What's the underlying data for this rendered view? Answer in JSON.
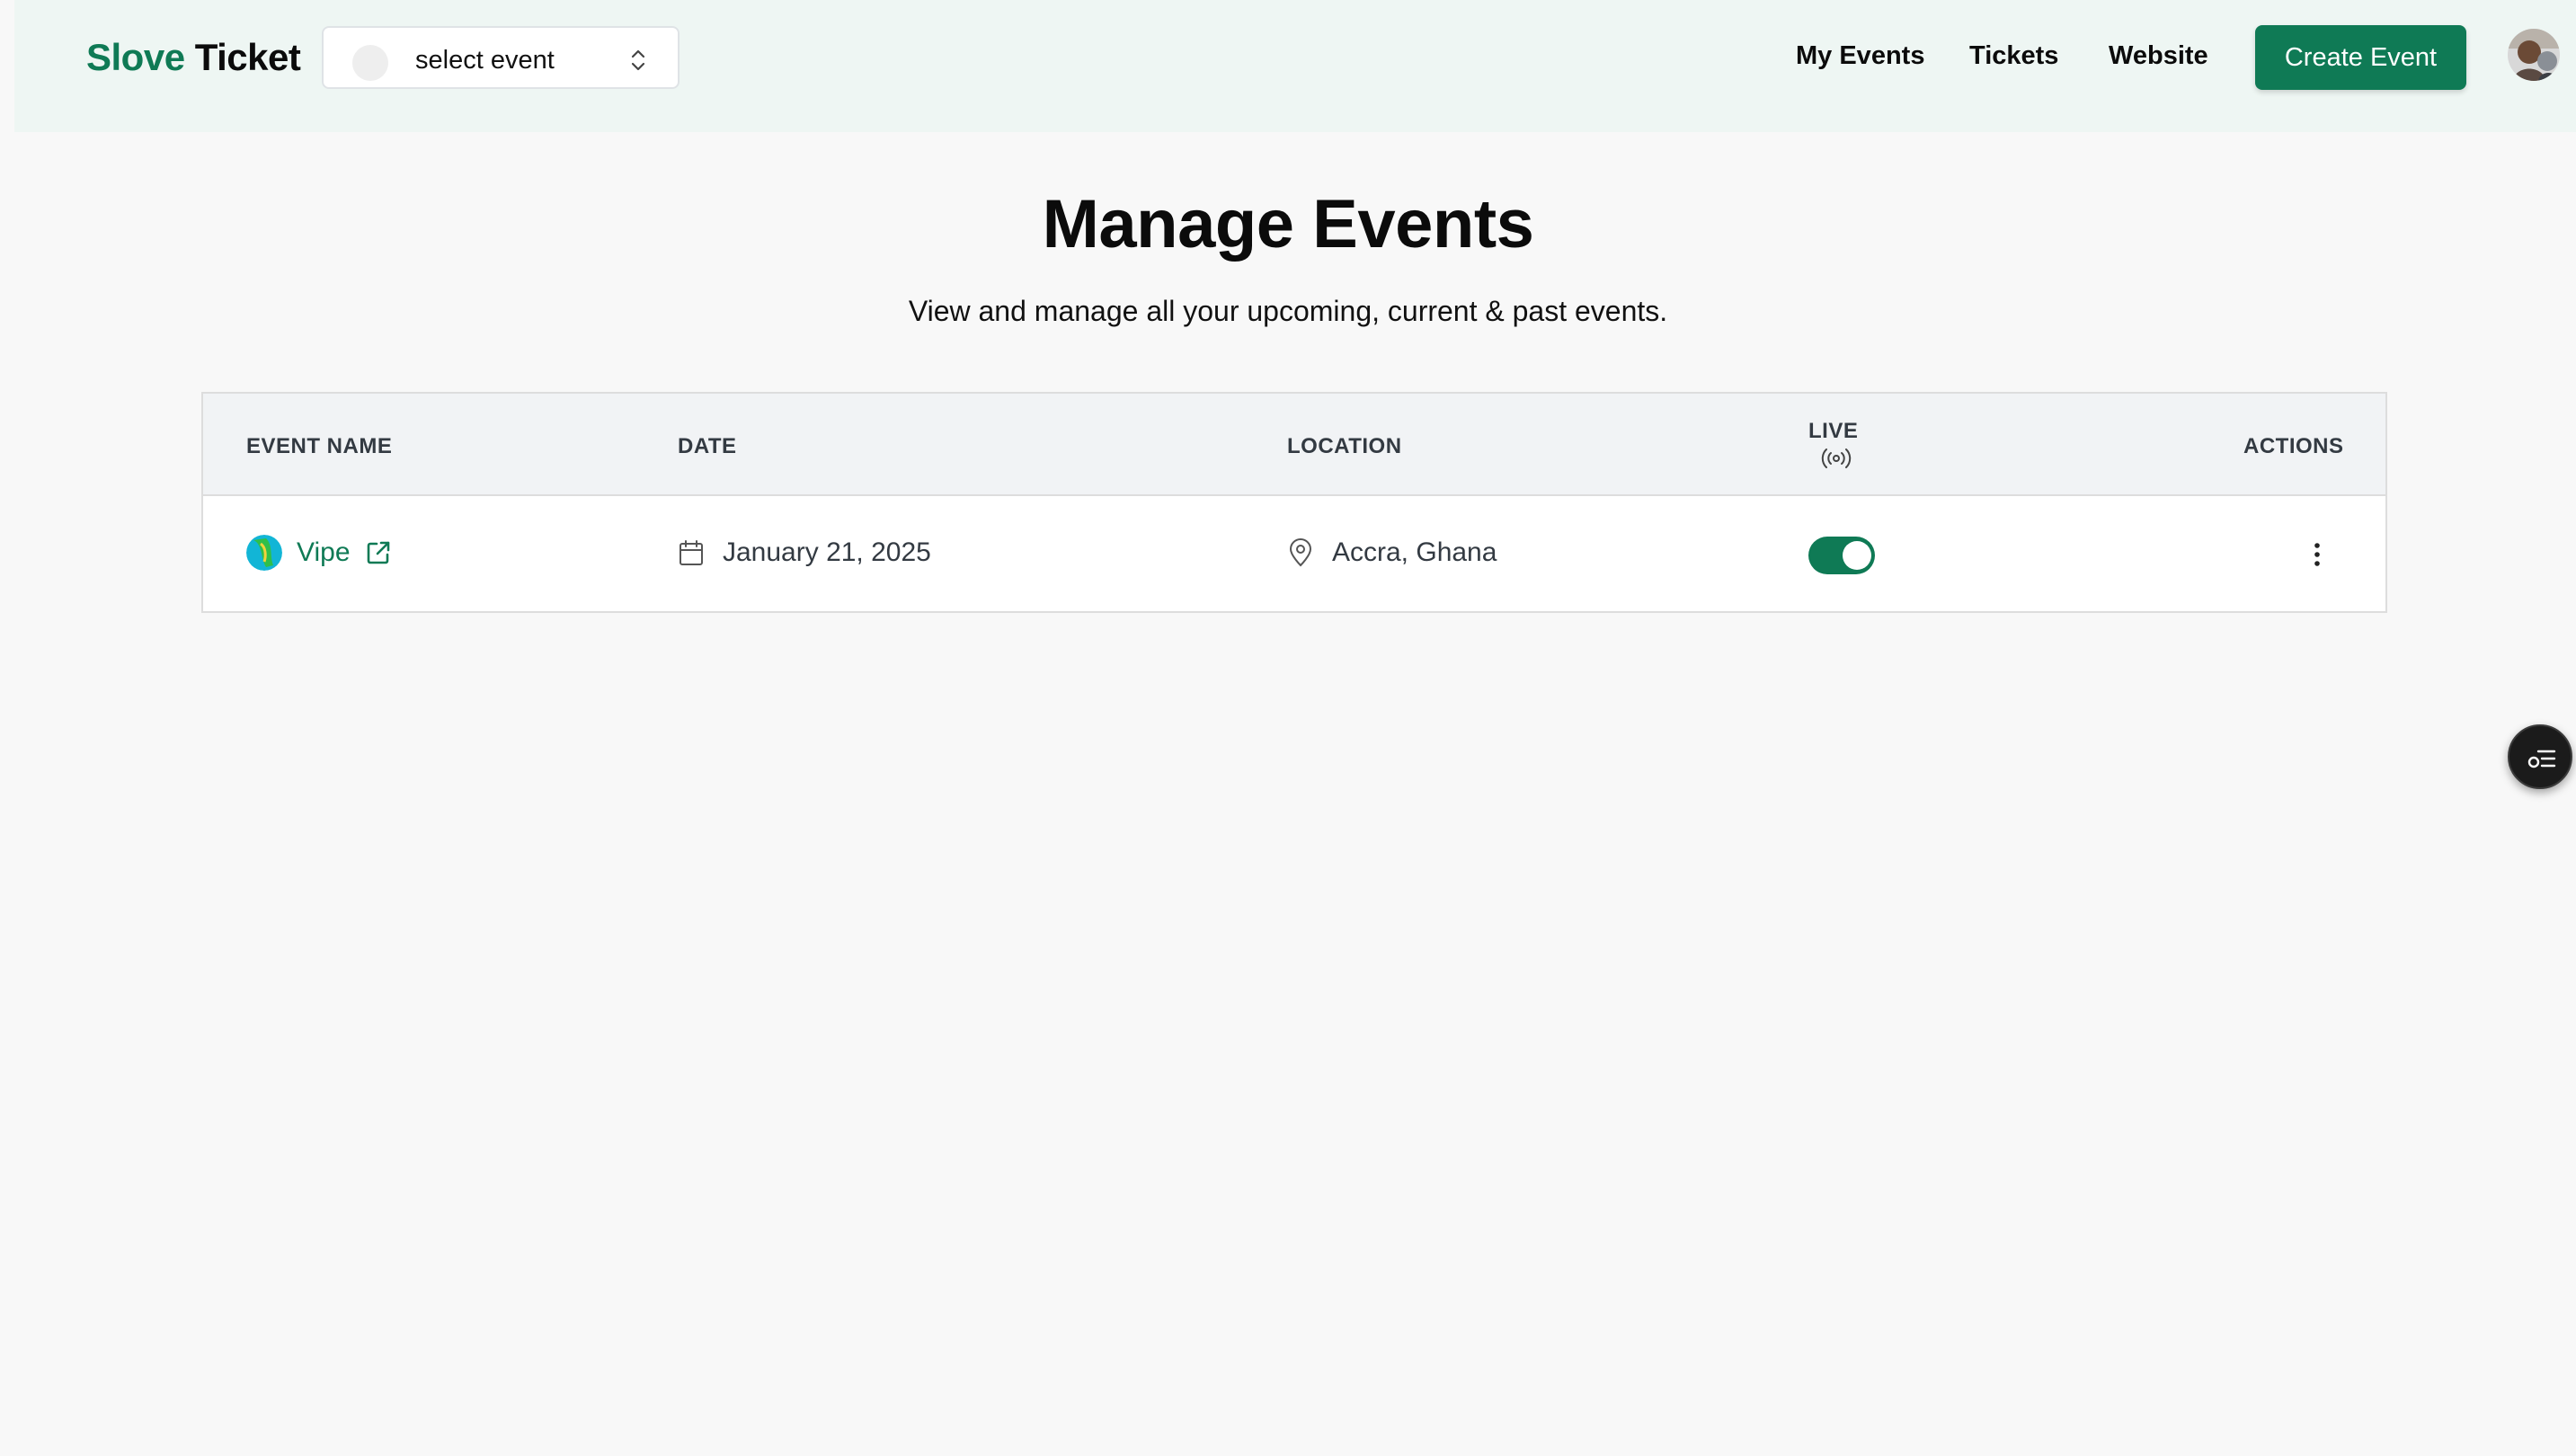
{
  "header": {
    "brand_part1": "Slove",
    "brand_part2": "Ticket",
    "event_selector": {
      "value": "select event"
    },
    "nav": [
      {
        "label": "My Events"
      },
      {
        "label": "Tickets"
      },
      {
        "label": "Website"
      }
    ],
    "create_button": "Create Event",
    "avatar_icon": "user-avatar"
  },
  "main": {
    "title": "Manage Events",
    "subtitle": "View and manage all your upcoming, current & past events."
  },
  "table": {
    "columns": {
      "event_name": "EVENT NAME",
      "date": "DATE",
      "location": "LOCATION",
      "live": "LIVE",
      "actions": "ACTIONS"
    },
    "rows": [
      {
        "name": "Vipe",
        "date": "January 21, 2025",
        "location": "Accra, Ghana",
        "live": true
      }
    ]
  },
  "colors": {
    "brand_green": "#0f7a55",
    "header_bg": "#eef6f3",
    "page_bg": "#f8f8f8"
  },
  "icons": [
    "chevron-updown-icon",
    "external-link-icon",
    "calendar-icon",
    "map-pin-icon",
    "broadcast-icon",
    "more-vertical-icon",
    "filter-list-icon"
  ]
}
